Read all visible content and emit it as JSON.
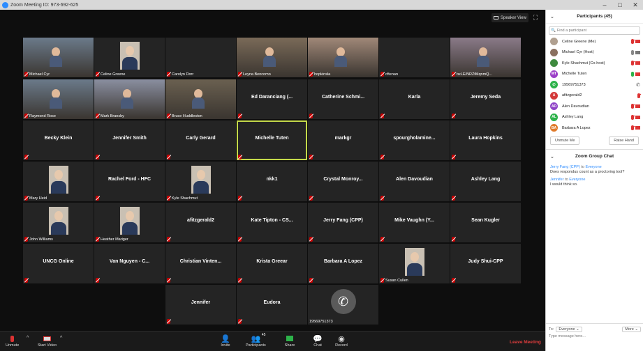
{
  "window": {
    "title": "Zoom Meeting ID: 973-692-625",
    "minimize": "–",
    "maximize": "□",
    "close": "✕"
  },
  "view": {
    "speaker_view_label": "Speaker View",
    "fullscreen_glyph": "⛶"
  },
  "tiles": [
    {
      "label": "Michael Cyr",
      "video": true
    },
    {
      "label": "Celine Greene",
      "photo": true
    },
    {
      "label": "Carolyn Dorr"
    },
    {
      "label": "Leyna Bencomo",
      "video": true
    },
    {
      "label": "hopkinsla",
      "video": true
    },
    {
      "label": "cftenan"
    },
    {
      "label": "bxLE/NRZtMqnmQ...",
      "video": true
    },
    {
      "label": "Raymond Rose",
      "video": true
    },
    {
      "label": "Mark Bransby",
      "video": true
    },
    {
      "label": "Bruce Huddleston",
      "video": true
    },
    {
      "name": "Ed Daranciang (..."
    },
    {
      "name": "Catherine Schmi..."
    },
    {
      "name": "Karla"
    },
    {
      "name": "Jeremy Seda"
    },
    {
      "name": "Becky Klein"
    },
    {
      "name": "Jennifer Smith"
    },
    {
      "name": "Carly Gerard"
    },
    {
      "name": "Michelle Tuten",
      "active": true
    },
    {
      "name": "markgr"
    },
    {
      "name": "spourgholamine..."
    },
    {
      "name": "Laura Hopkins"
    },
    {
      "label": "Mary Heid",
      "photo": true
    },
    {
      "name": "Rachel Ford - HFC"
    },
    {
      "label": "Kyle Shachmut",
      "photo": true
    },
    {
      "name": "nkk1"
    },
    {
      "name": "Crystal Monroy..."
    },
    {
      "name": "Alen Davoudian"
    },
    {
      "name": "Ashley Lang"
    },
    {
      "label": "John Williams",
      "photo": true
    },
    {
      "label": "Heather Mariger",
      "photo": true
    },
    {
      "name": "afitzgerald2"
    },
    {
      "name": "Kate Tipton - CS..."
    },
    {
      "name": "Jerry Fang (CPP)"
    },
    {
      "name": "Mike Vaughn (Y..."
    },
    {
      "name": "Sean Kugler"
    },
    {
      "name": "UNCG Online"
    },
    {
      "name": "Van Nguyen - C..."
    },
    {
      "name": "Christian Vinten..."
    },
    {
      "name": "Krista Greear"
    },
    {
      "name": "Barbara A Lopez"
    },
    {
      "label": "Susan Cullen",
      "photo": true
    },
    {
      "name": "Judy Shui-CPP"
    },
    {
      "name": "Jennifer"
    },
    {
      "name": "Eudora"
    },
    {
      "label": "19569751373",
      "phone": true
    }
  ],
  "toolbar": {
    "unmute": "Unmute",
    "start_video": "Start Video",
    "invite": "Invite",
    "participants": "Participants",
    "participants_count": "45",
    "share": "Share",
    "chat": "Chat",
    "record": "Record",
    "leave": "Leave Meeting"
  },
  "participants_panel": {
    "title": "Participants (45)",
    "search_placeholder": "Find a participant",
    "list": [
      {
        "name": "Celine Greene (Me)",
        "avatar_color": "#b0a090",
        "initials": "",
        "mic": "muted",
        "cam": "off"
      },
      {
        "name": "Michael Cyr (Host)",
        "avatar_color": "#8a7060",
        "initials": "",
        "mic": "gray",
        "cam": "on"
      },
      {
        "name": "Kyle Shachmut (Co-host)",
        "avatar_color": "#3e8a3e",
        "initials": "",
        "mic": "muted",
        "cam": "off"
      },
      {
        "name": "Michelle Tuten",
        "avatar_color": "#9b3fc7",
        "initials": "MT",
        "mic": "on",
        "cam": "off"
      },
      {
        "name": "19569751373",
        "avatar_color": "#2db34a",
        "initials": "",
        "mic": "phone",
        "cam": "none"
      },
      {
        "name": "afitzgerald2",
        "avatar_color": "#d33a3a",
        "initials": "A",
        "mic": "muted",
        "cam": "none"
      },
      {
        "name": "Alen Davoudian",
        "avatar_color": "#8e44c7",
        "initials": "AD",
        "mic": "muted",
        "cam": "off"
      },
      {
        "name": "Ashley Lang",
        "avatar_color": "#2db34a",
        "initials": "AL",
        "mic": "muted",
        "cam": "off"
      },
      {
        "name": "Barbara A Lopez",
        "avatar_color": "#e07a2a",
        "initials": "BA",
        "mic": "muted",
        "cam": "off"
      }
    ],
    "unmute_me": "Unmute Me",
    "raise_hand": "Raise Hand"
  },
  "chat_panel": {
    "title": "Zoom Group Chat",
    "messages": [
      {
        "from": "Jerry Fang (CPP)",
        "to_word": "to",
        "to": "Everyone",
        "text": "Does respondus count as a proctoring tool?"
      },
      {
        "from": "Jennifer",
        "to_word": "to",
        "to": "Everyone",
        "text": "I would think so."
      }
    ],
    "to_label": "To:",
    "to_value": "Everyone",
    "more": "More",
    "input_placeholder": "Type message here..."
  }
}
